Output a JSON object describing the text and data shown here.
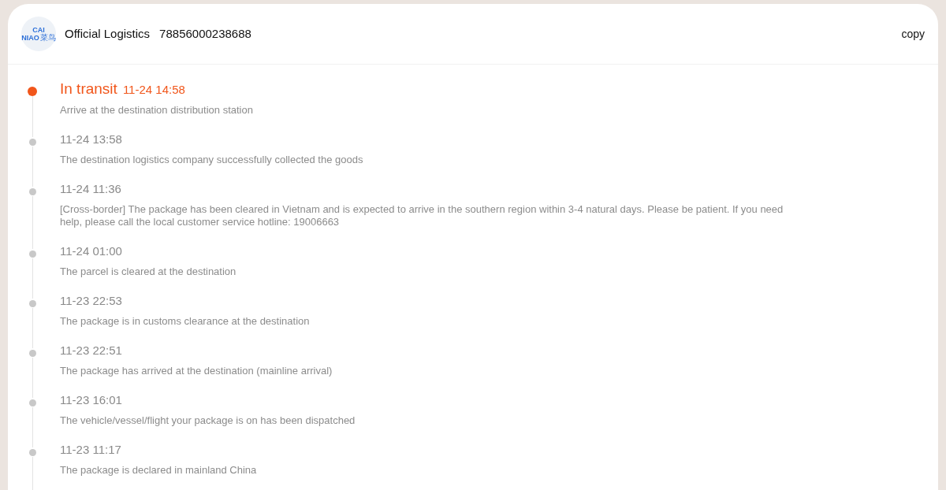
{
  "header": {
    "logo": {
      "line_1": "CAI",
      "line_2": "NIAO",
      "chinese": "菜鸟"
    },
    "carrier": "Official Logistics",
    "tracking_number": "78856000238688",
    "copy_label": "copy"
  },
  "events": [
    {
      "current": true,
      "status": "In transit",
      "time": "11-24 14:58",
      "description": "Arrive at the destination distribution station"
    },
    {
      "current": false,
      "time": "11-24 13:58",
      "description": "The destination logistics company successfully collected the goods"
    },
    {
      "current": false,
      "time": "11-24 11:36",
      "description": "[Cross-border] The package has been cleared in Vietnam and is expected to arrive in the southern region within 3-4 natural days. Please be patient. If you need help, please call the local customer service hotline: 19006663"
    },
    {
      "current": false,
      "time": "11-24 01:00",
      "description": "The parcel is cleared at the destination"
    },
    {
      "current": false,
      "time": "11-23 22:53",
      "description": "The package is in customs clearance at the destination"
    },
    {
      "current": false,
      "time": "11-23 22:51",
      "description": "The package has arrived at the destination (mainline arrival)"
    },
    {
      "current": false,
      "time": "11-23 16:01",
      "description": "The vehicle/vessel/flight your package is on has been dispatched"
    },
    {
      "current": false,
      "time": "11-23 11:17",
      "description": "The package is declared in mainland China"
    }
  ]
}
